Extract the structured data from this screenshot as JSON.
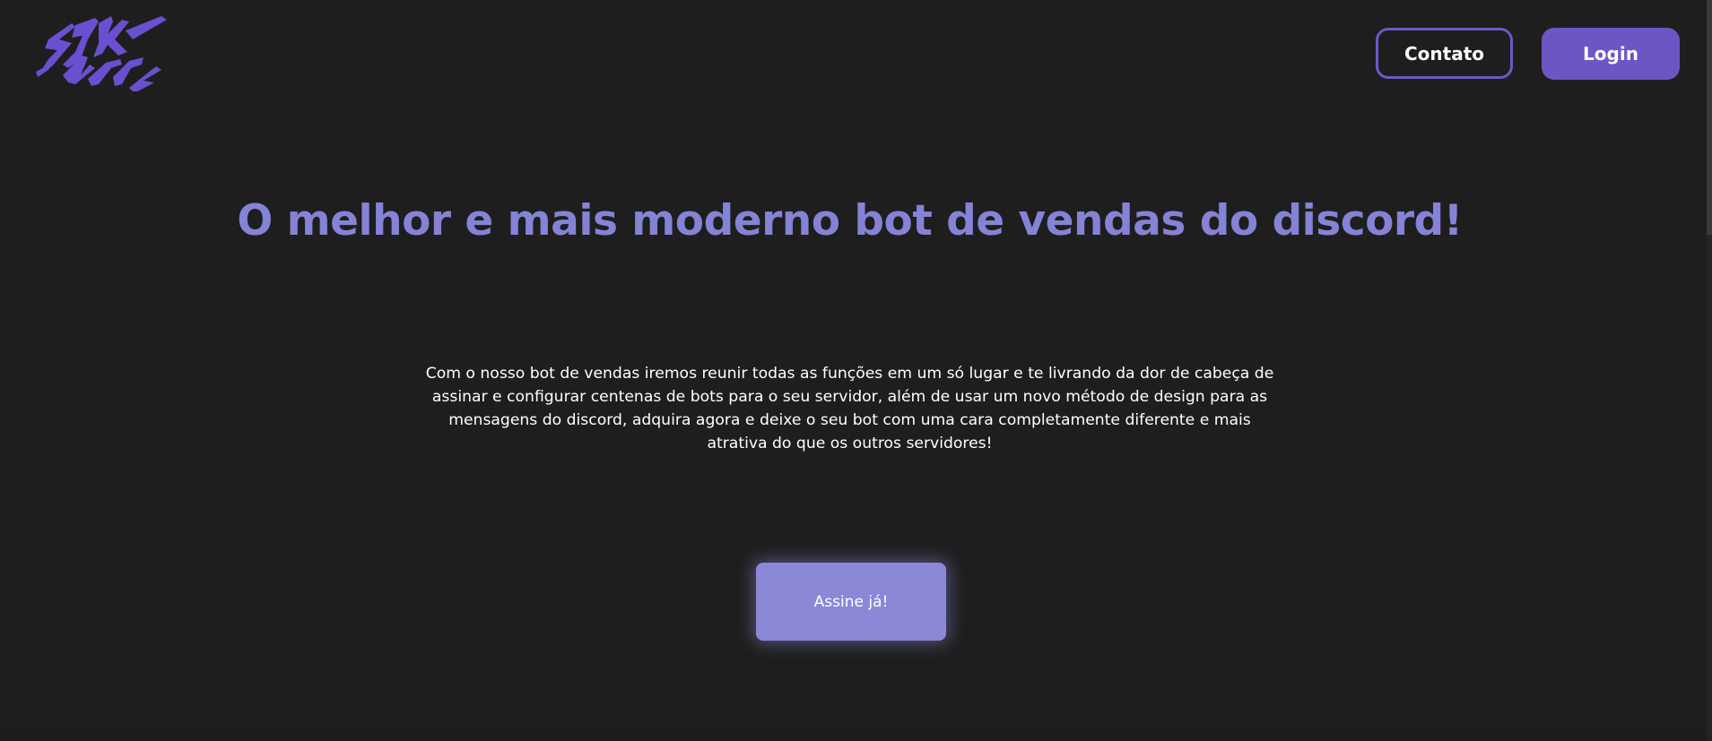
{
  "header": {
    "logo_icon": "zyk-apps-logo",
    "contact_label": "Contato",
    "login_label": "Login"
  },
  "hero": {
    "headline": "O melhor e mais moderno bot de vendas do discord!",
    "description": "Com o nosso bot de vendas iremos reunir todas as funções em um só lugar e te livrando da dor de cabeça de assinar e configurar centenas de bots para o seu servidor, além de usar um novo método de design para as mensagens do discord, adquira agora e deixe o seu bot com uma cara completamente diferente e mais atrativa do que os outros servidores!",
    "cta_label": "Assine já!"
  },
  "colors": {
    "background": "#1e1e1e",
    "accent": "#6c55c4",
    "headline": "#8483d6",
    "cta": "#8b89d7"
  }
}
